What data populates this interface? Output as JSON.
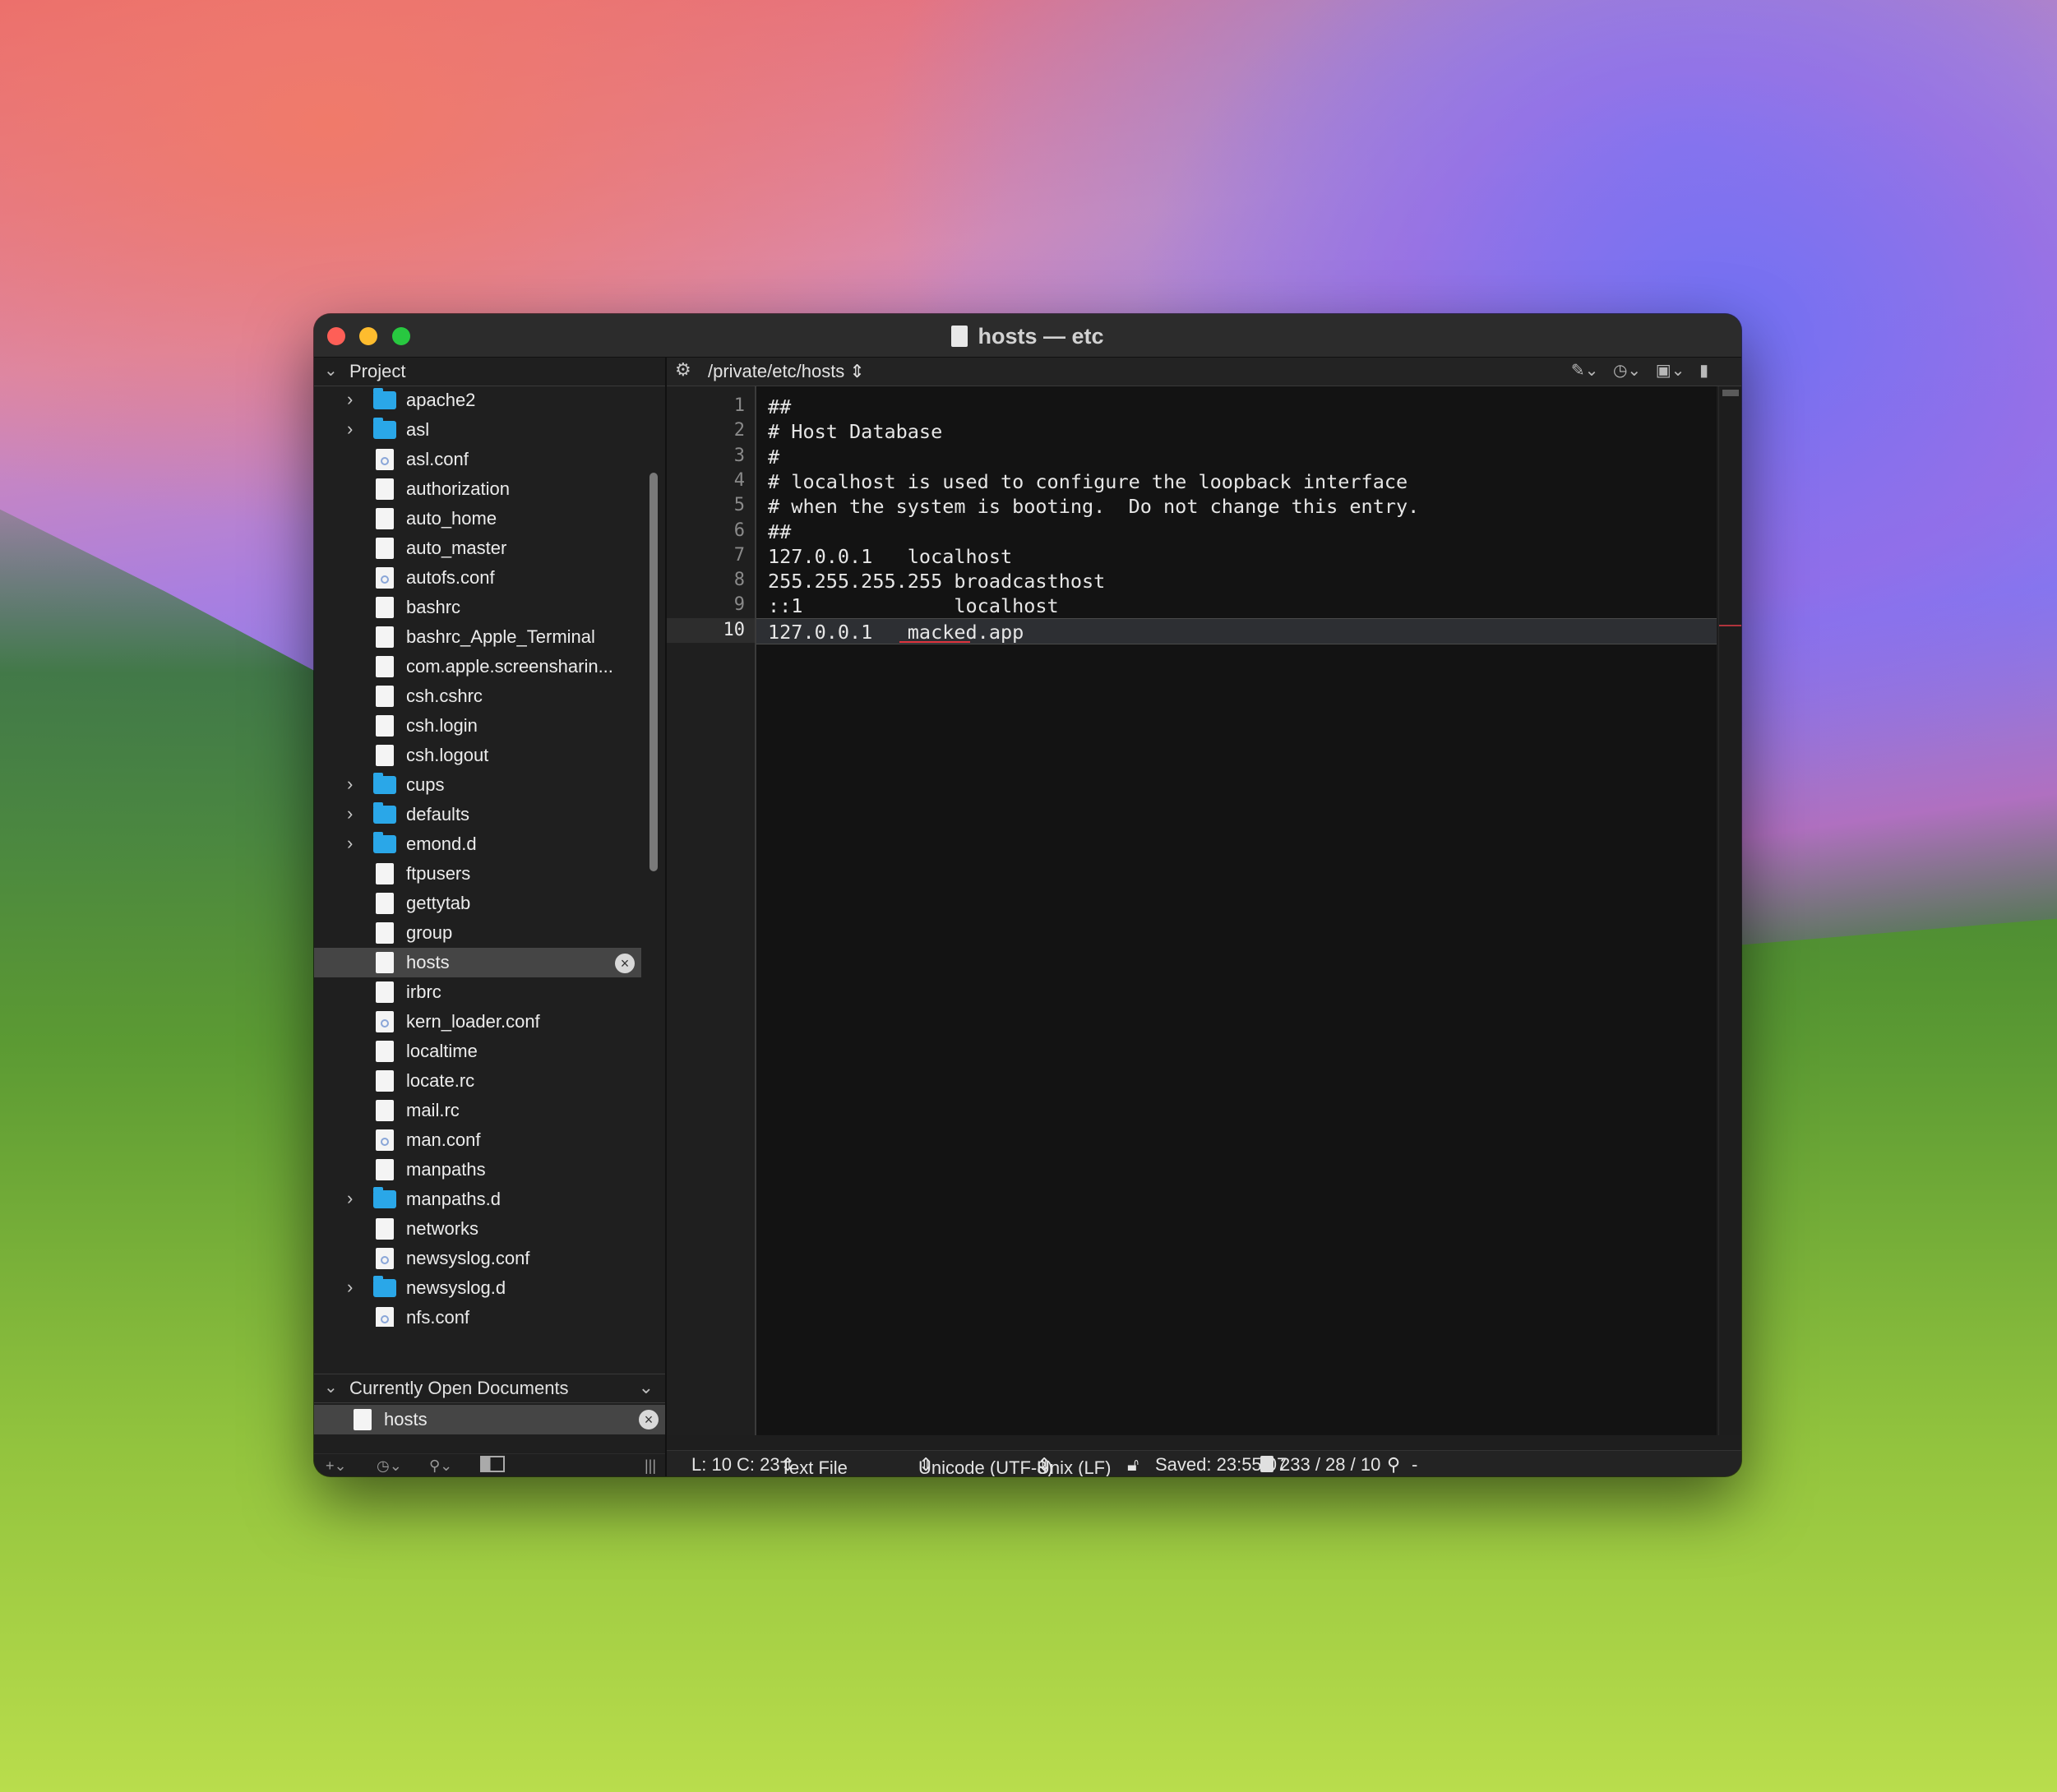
{
  "window": {
    "title": "hosts — etc"
  },
  "sidebar": {
    "project_label": "Project",
    "items": [
      {
        "name": "apache2",
        "kind": "folder",
        "expandable": true
      },
      {
        "name": "asl",
        "kind": "folder",
        "expandable": true
      },
      {
        "name": "asl.conf",
        "kind": "conf"
      },
      {
        "name": "authorization",
        "kind": "file"
      },
      {
        "name": "auto_home",
        "kind": "file"
      },
      {
        "name": "auto_master",
        "kind": "file"
      },
      {
        "name": "autofs.conf",
        "kind": "conf"
      },
      {
        "name": "bashrc",
        "kind": "file"
      },
      {
        "name": "bashrc_Apple_Terminal",
        "kind": "file"
      },
      {
        "name": "com.apple.screensharin...",
        "kind": "file"
      },
      {
        "name": "csh.cshrc",
        "kind": "file"
      },
      {
        "name": "csh.login",
        "kind": "file"
      },
      {
        "name": "csh.logout",
        "kind": "file"
      },
      {
        "name": "cups",
        "kind": "folder",
        "expandable": true
      },
      {
        "name": "defaults",
        "kind": "folder",
        "expandable": true
      },
      {
        "name": "emond.d",
        "kind": "folder",
        "expandable": true
      },
      {
        "name": "ftpusers",
        "kind": "file"
      },
      {
        "name": "gettytab",
        "kind": "file"
      },
      {
        "name": "group",
        "kind": "file"
      },
      {
        "name": "hosts",
        "kind": "file",
        "selected": true
      },
      {
        "name": "irbrc",
        "kind": "file"
      },
      {
        "name": "kern_loader.conf",
        "kind": "conf"
      },
      {
        "name": "localtime",
        "kind": "file"
      },
      {
        "name": "locate.rc",
        "kind": "file"
      },
      {
        "name": "mail.rc",
        "kind": "file"
      },
      {
        "name": "man.conf",
        "kind": "conf"
      },
      {
        "name": "manpaths",
        "kind": "file"
      },
      {
        "name": "manpaths.d",
        "kind": "folder",
        "expandable": true
      },
      {
        "name": "networks",
        "kind": "file"
      },
      {
        "name": "newsyslog.conf",
        "kind": "conf"
      },
      {
        "name": "newsyslog.d",
        "kind": "folder",
        "expandable": true
      },
      {
        "name": "nfs.conf",
        "kind": "conf"
      }
    ],
    "open_docs_label": "Currently Open Documents",
    "open_docs": [
      "hosts"
    ]
  },
  "navbar": {
    "path": "/private/etc/hosts"
  },
  "editor": {
    "current_line": 10,
    "lines": [
      "##",
      "# Host Database",
      "#",
      "# localhost is used to configure the loopback interface",
      "# when the system is booting.  Do not change this entry.",
      "##",
      "127.0.0.1   localhost",
      "255.255.255.255 broadcasthost",
      "::1             localhost",
      "127.0.0.1   macked.app"
    ]
  },
  "status": {
    "position": "L: 10 C: 23",
    "file_type": "Text File",
    "encoding": "Unicode (UTF-8)",
    "line_endings": "Unix (LF)",
    "saved": "Saved: 23:55:07",
    "counts": "233 / 28 / 10",
    "search_suffix": "-"
  }
}
